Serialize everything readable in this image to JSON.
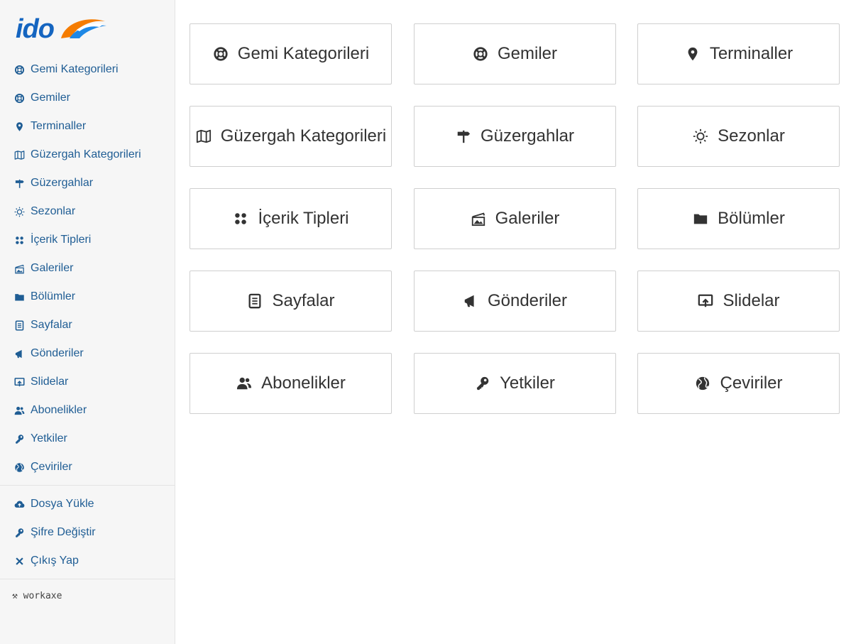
{
  "brand": {
    "logo_text": "ido",
    "accent": "#1565c0",
    "swoosh_colors": [
      "#f57c00",
      "#1e88e5"
    ]
  },
  "sidebar": {
    "items": [
      {
        "label": "Gemi Kategorileri",
        "icon": "lifebuoy-icon"
      },
      {
        "label": "Gemiler",
        "icon": "lifebuoy-icon"
      },
      {
        "label": "Terminaller",
        "icon": "map-pin-icon"
      },
      {
        "label": "Güzergah Kategorileri",
        "icon": "map-icon"
      },
      {
        "label": "Güzergahlar",
        "icon": "signpost-icon"
      },
      {
        "label": "Sezonlar",
        "icon": "sun-icon"
      },
      {
        "label": "İçerik Tipleri",
        "icon": "grid-dots-icon"
      },
      {
        "label": "Galeriler",
        "icon": "gallery-icon"
      },
      {
        "label": "Bölümler",
        "icon": "folder-icon"
      },
      {
        "label": "Sayfalar",
        "icon": "document-icon"
      },
      {
        "label": "Gönderiler",
        "icon": "megaphone-icon"
      },
      {
        "label": "Slidelar",
        "icon": "upload-screen-icon"
      },
      {
        "label": "Abonelikler",
        "icon": "users-icon"
      },
      {
        "label": "Yetkiler",
        "icon": "key-icon"
      },
      {
        "label": "Çeviriler",
        "icon": "globe-icon"
      }
    ],
    "account": [
      {
        "label": "Dosya Yükle",
        "icon": "cloud-upload-icon"
      },
      {
        "label": "Şifre Değiştir",
        "icon": "key-icon"
      },
      {
        "label": "Çıkış Yap",
        "icon": "close-icon"
      }
    ],
    "footer": "⚒ workaxe"
  },
  "tiles": [
    {
      "label": "Gemi Kategorileri",
      "icon": "lifebuoy-icon"
    },
    {
      "label": "Gemiler",
      "icon": "lifebuoy-icon"
    },
    {
      "label": "Terminaller",
      "icon": "map-pin-icon"
    },
    {
      "label": "Güzergah Kategorileri",
      "icon": "map-icon"
    },
    {
      "label": "Güzergahlar",
      "icon": "signpost-icon"
    },
    {
      "label": "Sezonlar",
      "icon": "sun-icon"
    },
    {
      "label": "İçerik Tipleri",
      "icon": "grid-dots-icon"
    },
    {
      "label": "Galeriler",
      "icon": "gallery-icon"
    },
    {
      "label": "Bölümler",
      "icon": "folder-icon"
    },
    {
      "label": "Sayfalar",
      "icon": "document-icon"
    },
    {
      "label": "Gönderiler",
      "icon": "megaphone-icon"
    },
    {
      "label": "Slidelar",
      "icon": "upload-screen-icon"
    },
    {
      "label": "Abonelikler",
      "icon": "users-icon"
    },
    {
      "label": "Yetkiler",
      "icon": "key-icon"
    },
    {
      "label": "Çeviriler",
      "icon": "globe-icon"
    }
  ]
}
